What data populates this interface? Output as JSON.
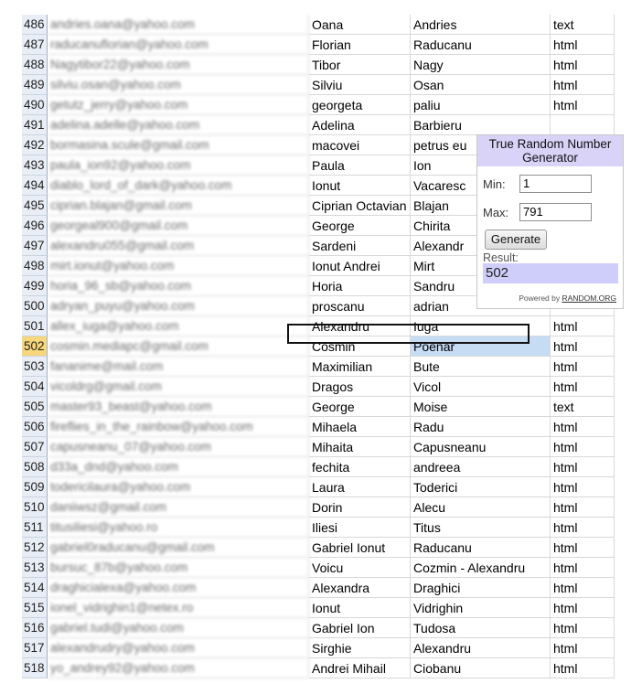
{
  "rows": [
    {
      "n": "486",
      "email": "andries.oana@yahoo.com",
      "first": "Oana",
      "last": "Andries",
      "type": "text"
    },
    {
      "n": "487",
      "email": "raducanuflorian@yahoo.com",
      "first": "Florian",
      "last": "Raducanu",
      "type": "html"
    },
    {
      "n": "488",
      "email": "Nagytibor22@yahoo.com",
      "first": "Tibor",
      "last": "Nagy",
      "type": "html"
    },
    {
      "n": "489",
      "email": "silviu.osan@yahoo.com",
      "first": "Silviu",
      "last": "Osan",
      "type": "html"
    },
    {
      "n": "490",
      "email": "getutz_jerry@yahoo.com",
      "first": "georgeta",
      "last": "paliu",
      "type": "html"
    },
    {
      "n": "491",
      "email": "adelina.adelle@yahoo.com",
      "first": "Adelina",
      "last": "Barbieru",
      "type": ""
    },
    {
      "n": "492",
      "email": "bormasina.scule@gmail.com",
      "first": "macovei",
      "last": "petrus eu",
      "type": ""
    },
    {
      "n": "493",
      "email": "paula_ion92@yahoo.com",
      "first": "Paula",
      "last": "Ion",
      "type": ""
    },
    {
      "n": "494",
      "email": "diablo_lord_of_dark@yahoo.com",
      "first": "Ionut",
      "last": "Vacaresc",
      "type": ""
    },
    {
      "n": "495",
      "email": "ciprian.blajan@gmail.com",
      "first": "Ciprian Octavian",
      "last": "Blajan",
      "type": ""
    },
    {
      "n": "496",
      "email": "georgeal900@gmail.com",
      "first": "George",
      "last": "Chirita",
      "type": ""
    },
    {
      "n": "497",
      "email": "alexandru055@gmail.com",
      "first": "Sardeni",
      "last": "Alexandr",
      "type": ""
    },
    {
      "n": "498",
      "email": "mirt.ionut@yahoo.com",
      "first": "Ionut Andrei",
      "last": "Mirt",
      "type": ""
    },
    {
      "n": "499",
      "email": "horia_96_sb@yahoo.com",
      "first": "Horia",
      "last": "Sandru",
      "type": ""
    },
    {
      "n": "500",
      "email": "adryan_puyu@yahoo.com",
      "first": "proscanu",
      "last": "adrian",
      "type": ""
    },
    {
      "n": "501",
      "email": "allex_iuga@yahoo.com",
      "first": "Alexandru",
      "last": "Iuga",
      "type": "html"
    },
    {
      "n": "502",
      "email": "cosmin.mediapc@gmail.com",
      "first": "Cosmin",
      "last": "Poenar",
      "type": "html"
    },
    {
      "n": "503",
      "email": "fananime@mail.com",
      "first": "Maximilian",
      "last": "Bute",
      "type": "html"
    },
    {
      "n": "504",
      "email": "vicoldrg@gmail.com",
      "first": "Dragos",
      "last": "Vicol",
      "type": "html"
    },
    {
      "n": "505",
      "email": "master93_beast@yahoo.com",
      "first": "George",
      "last": "Moise",
      "type": "text"
    },
    {
      "n": "506",
      "email": "fireflies_in_the_rainbow@yahoo.com",
      "first": "Mihaela",
      "last": "Radu",
      "type": "html"
    },
    {
      "n": "507",
      "email": "capusneanu_07@yahoo.com",
      "first": "Mihaita",
      "last": "Capusneanu",
      "type": "html"
    },
    {
      "n": "508",
      "email": "d33a_dnd@yahoo.com",
      "first": "fechita",
      "last": "andreea",
      "type": "html"
    },
    {
      "n": "509",
      "email": "todericilaura@yahoo.com",
      "first": "Laura",
      "last": "Toderici",
      "type": "html"
    },
    {
      "n": "510",
      "email": "daniiwsz@gmail.com",
      "first": "Dorin",
      "last": "Alecu",
      "type": "html"
    },
    {
      "n": "511",
      "email": "titusiliesi@yahoo.ro",
      "first": "Iliesi",
      "last": "Titus",
      "type": "html"
    },
    {
      "n": "512",
      "email": "gabriel0raducanu@gmail.com",
      "first": "Gabriel Ionut",
      "last": "Raducanu",
      "type": "html"
    },
    {
      "n": "513",
      "email": "bursuc_87b@yahoo.com",
      "first": "Voicu",
      "last": "Cozmin - Alexandru",
      "type": "html"
    },
    {
      "n": "514",
      "email": "draghicialexa@yahoo.com",
      "first": "Alexandra",
      "last": "Draghici",
      "type": "html"
    },
    {
      "n": "515",
      "email": "ionel_vidrighin1@netex.ro",
      "first": "Ionut",
      "last": "Vidrighin",
      "type": "html"
    },
    {
      "n": "516",
      "email": "gabriel.tudi@yahoo.com",
      "first": "Gabriel Ion",
      "last": "Tudosa",
      "type": "html"
    },
    {
      "n": "517",
      "email": "alexandrudry@yahoo.com",
      "first": "Sirghie",
      "last": "Alexandru",
      "type": "html"
    },
    {
      "n": "518",
      "email": "yo_andrey92@yahoo.com",
      "first": "Andrei Mihail",
      "last": "Ciobanu",
      "type": "html"
    }
  ],
  "selected_row": "502",
  "widget": {
    "title": "True Random Number Generator",
    "min_label": "Min:",
    "min_value": "1",
    "max_label": "Max:",
    "max_value": "791",
    "button_label": "Generate",
    "result_label": "Result:",
    "result_value": "502",
    "powered_prefix": "Powered by",
    "powered_link": "RANDOM.ORG"
  }
}
